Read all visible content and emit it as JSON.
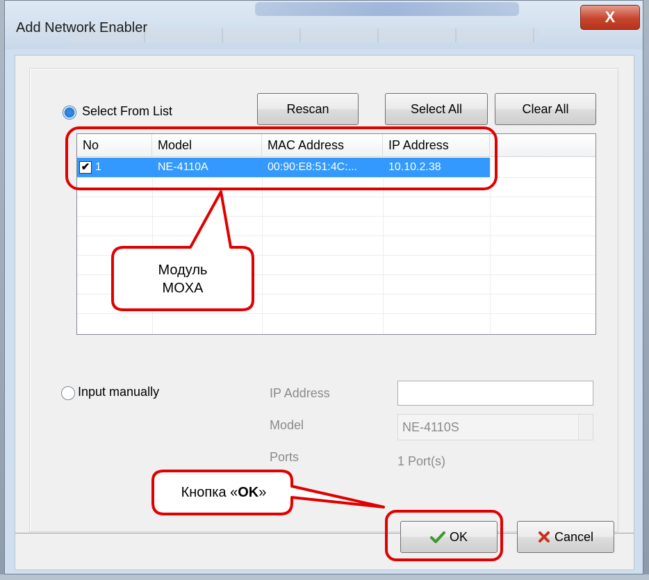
{
  "window": {
    "title": "Add Network Enabler",
    "close_glyph": "X"
  },
  "select_from_list": {
    "label": "Select From List",
    "checked": true
  },
  "buttons": {
    "rescan": "Rescan",
    "select_all": "Select All",
    "clear_all": "Clear All",
    "ok": "OK",
    "cancel": "Cancel"
  },
  "list": {
    "columns": [
      "No",
      "Model",
      "MAC Address",
      "IP Address"
    ],
    "rows": [
      {
        "checked": true,
        "no": "1",
        "model": "NE-4110A",
        "mac": "00:90:E8:51:4C:...",
        "ip": "10.10.2.38"
      }
    ]
  },
  "manual": {
    "label": "Input manually",
    "ip_label": "IP Address",
    "ip_value": "",
    "model_label": "Model",
    "model_value": "NE-4110S",
    "ports_label": "Ports",
    "ports_value": "1 Port(s)"
  },
  "annotations": {
    "module_callout": [
      "Модуль",
      "MOXA"
    ],
    "ok_callout_prefix": "Кнопка «",
    "ok_callout_bold": "OK",
    "ok_callout_suffix": "»",
    "color": "#e00000"
  },
  "icons": {
    "ok": "checkmark-icon",
    "cancel": "cross-icon",
    "checkbox": "checkbox-checked-icon"
  }
}
